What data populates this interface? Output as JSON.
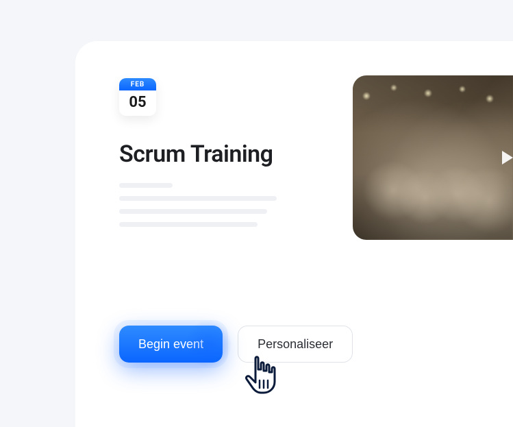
{
  "date": {
    "month": "FEB",
    "day": "05"
  },
  "title": "Scrum Training",
  "actions": {
    "primary": "Begin event",
    "secondary": "Personaliseer"
  }
}
